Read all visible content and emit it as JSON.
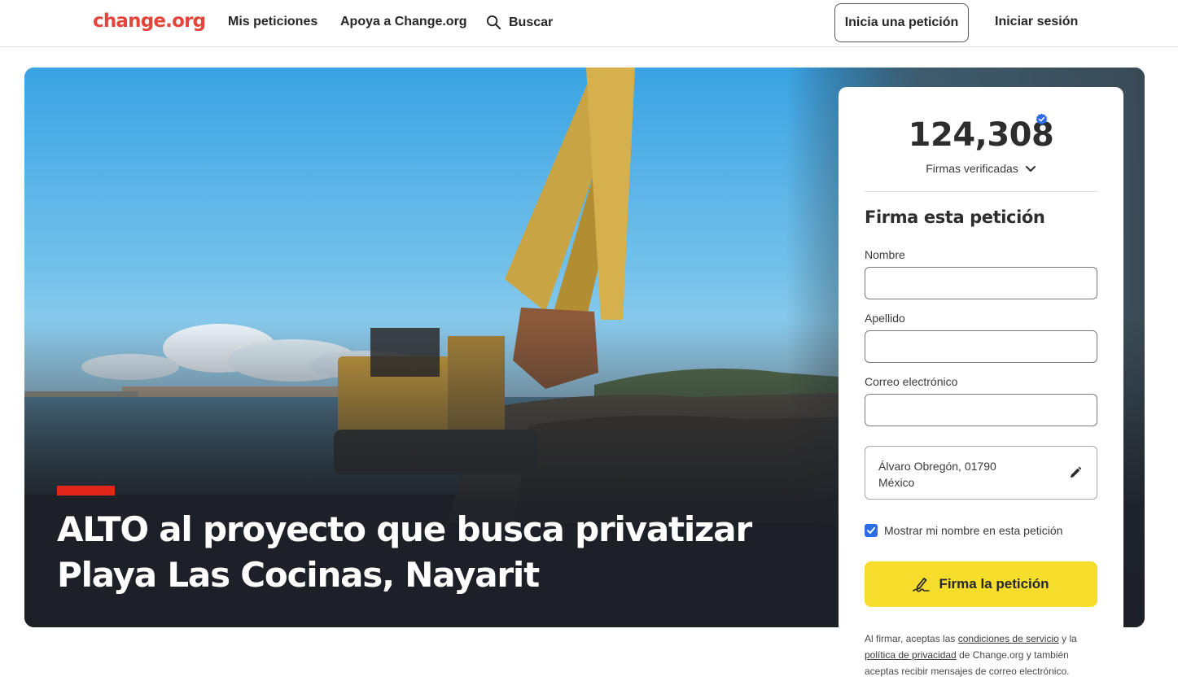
{
  "header": {
    "logo": "change.org",
    "nav": {
      "mis_peticiones": "Mis peticiones",
      "apoya": "Apoya a Change.org",
      "buscar": "Buscar"
    },
    "start_button": "Inicia una petición",
    "login": "Iniciar sesión"
  },
  "hero": {
    "title": "ALTO al proyecto que busca privatizar Playa Las Cocinas, Nayarit",
    "image_icon": "excavator-photo",
    "accent_color": "#e1261c"
  },
  "sign_card": {
    "count": "124,308",
    "verified_icon": "verified-badge-icon",
    "verified_label": "Firmas verificadas",
    "title": "Firma esta petición",
    "fields": {
      "nombre_label": "Nombre",
      "nombre_value": "",
      "apellido_label": "Apellido",
      "apellido_value": "",
      "correo_label": "Correo electrónico",
      "correo_value": ""
    },
    "location_line1": "Álvaro Obregón, 01790",
    "location_line2": "México",
    "show_name_label": "Mostrar mi nombre en esta petición",
    "show_name_checked": true,
    "sign_button": "Firma la petición",
    "legal": {
      "prefix": "Al firmar, aceptas las ",
      "terms_link": "condiciones de servicio",
      "middle": " y la ",
      "privacy_link": "política de privacidad",
      "suffix": " de Change.org y también aceptas recibir mensajes de correo electrónico."
    }
  },
  "colors": {
    "brand": "#e2463b",
    "button_yellow": "#f6dd2c",
    "checkbox_blue": "#2e6be6"
  }
}
